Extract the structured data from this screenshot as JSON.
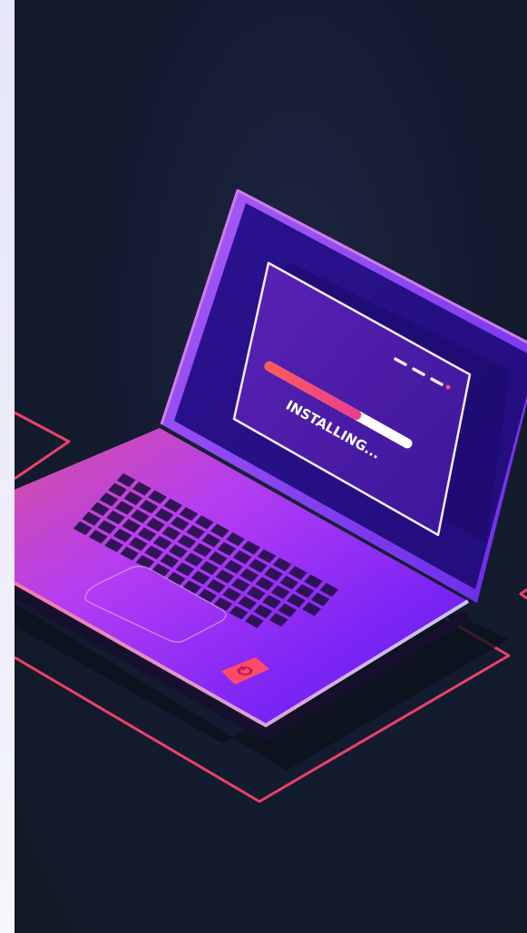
{
  "illustration": {
    "install_label": "INSTALLING...",
    "progress_fraction": 0.63,
    "colors": {
      "background": "#141b30",
      "laptop_purple": "#7b2cf0",
      "laptop_magenta": "#c23cf2",
      "screen_bezel": "#2a0f85",
      "window_fill": "#4a1ca8",
      "progress_fill": "#ff4f6b",
      "progress_track": "#ffffff",
      "neon_outline": "#e8426b",
      "key_color": "#241046"
    },
    "icons": [
      "power-icon"
    ]
  }
}
